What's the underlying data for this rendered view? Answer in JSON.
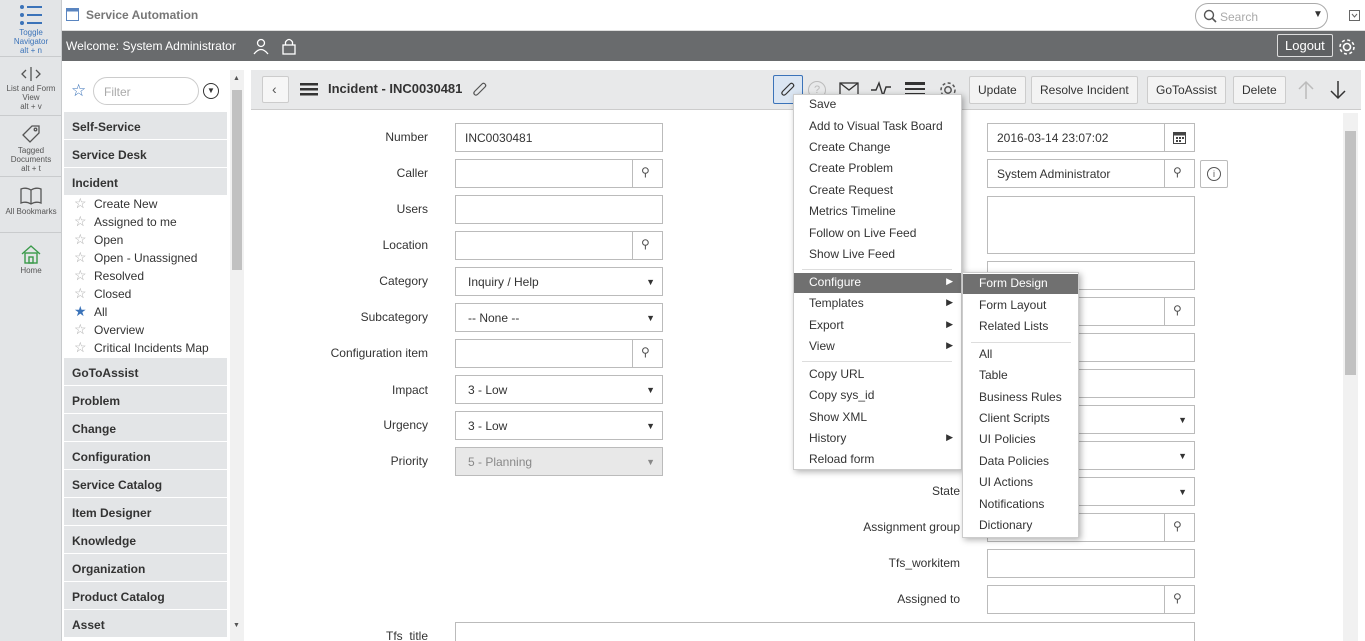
{
  "rail": {
    "items": [
      {
        "label": "Toggle Navigator",
        "shortcut": "alt + n",
        "icon": "list-icon"
      },
      {
        "label": "List and Form View",
        "shortcut": "alt + v",
        "icon": "split-view-icon"
      },
      {
        "label": "Tagged Documents",
        "shortcut": "alt + t",
        "icon": "tag-icon"
      },
      {
        "label": "All Bookmarks",
        "shortcut": "",
        "icon": "book-icon"
      },
      {
        "label": "Home",
        "shortcut": "",
        "icon": "home-icon"
      }
    ]
  },
  "topbar": {
    "app_title": "Service Automation",
    "search_placeholder": "Search"
  },
  "welcome": {
    "text": "Welcome:  System Administrator",
    "logout_label": "Logout"
  },
  "nav": {
    "filter_placeholder": "Filter",
    "sections_top": [
      "Self-Service",
      "Service Desk",
      "Incident"
    ],
    "incident_modules": [
      "Create New",
      "Assigned to me",
      "Open",
      "Open - Unassigned",
      "Resolved",
      "Closed",
      "All",
      "Overview",
      "Critical Incidents Map"
    ],
    "sections_bottom": [
      "GoToAssist",
      "Problem",
      "Change",
      "Configuration",
      "Service Catalog",
      "Item Designer",
      "Knowledge",
      "Organization",
      "Product Catalog",
      "Asset"
    ]
  },
  "header": {
    "title": "Incident - INC0030481",
    "buttons": [
      "Update",
      "Resolve Incident",
      "GoToAssist",
      "Delete"
    ]
  },
  "form_left": [
    {
      "label": "Number",
      "value": "INC0030481",
      "kind": "text"
    },
    {
      "label": "Caller",
      "value": "",
      "kind": "ref"
    },
    {
      "label": "Users",
      "value": "",
      "kind": "text"
    },
    {
      "label": "Location",
      "value": "",
      "kind": "ref"
    },
    {
      "label": "Category",
      "value": "Inquiry / Help",
      "kind": "select"
    },
    {
      "label": "Subcategory",
      "value": "-- None --",
      "kind": "select"
    },
    {
      "label": "Configuration item",
      "value": "",
      "kind": "ref"
    },
    {
      "label": "Impact",
      "value": "3 - Low",
      "kind": "select"
    },
    {
      "label": "Urgency",
      "value": "3 - Low",
      "kind": "select"
    },
    {
      "label": "Priority",
      "value": "5 - Planning",
      "kind": "select-disabled"
    }
  ],
  "form_right": {
    "opened": "2016-03-14 23:07:02",
    "opened_by": "System Administrator",
    "state_label": "State",
    "assignment_group_label": "Assignment group",
    "tfs_workitem_label": "Tfs_workitem",
    "assigned_to_label": "Assigned to"
  },
  "tfs_title_label": "Tfs_title",
  "context_menu": {
    "group1": [
      "Save",
      "Add to Visual Task Board",
      "Create Change",
      "Create Problem",
      "Create Request",
      "Metrics Timeline",
      "Follow on Live Feed",
      "Show Live Feed"
    ],
    "group2": [
      "Configure",
      "Templates",
      "Export",
      "View"
    ],
    "group3": [
      "Copy URL",
      "Copy sys_id",
      "Show XML",
      "History",
      "Reload form"
    ]
  },
  "submenu": {
    "group1": [
      "Form Design",
      "Form Layout",
      "Related Lists"
    ],
    "group2": [
      "All",
      "Table",
      "Business Rules",
      "Client Scripts",
      "UI Policies",
      "Data Policies",
      "UI Actions",
      "Notifications",
      "Dictionary"
    ]
  }
}
